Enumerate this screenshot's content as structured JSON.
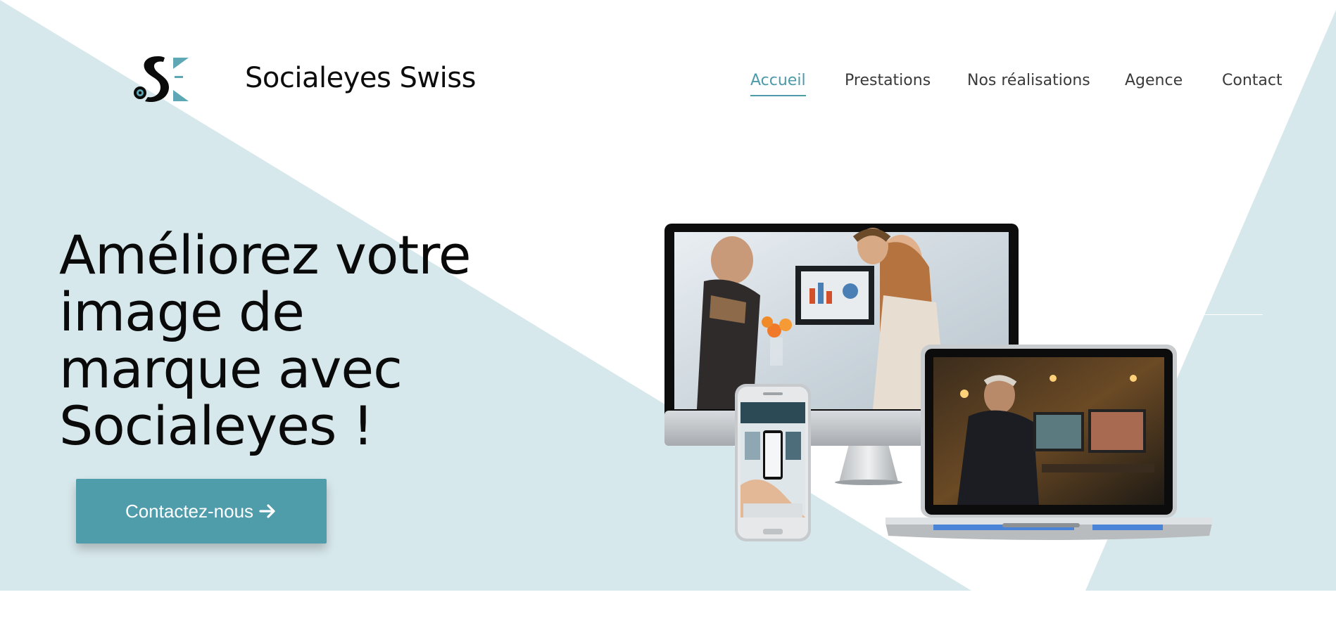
{
  "brand": {
    "name": "Socialeyes Swiss",
    "logo_icon": "socialeyes-se-logo"
  },
  "nav": {
    "items": [
      {
        "label": "Accueil",
        "active": true
      },
      {
        "label": "Prestations",
        "active": false
      },
      {
        "label": "Nos réalisations",
        "active": false
      },
      {
        "label": "Agence",
        "active": false
      },
      {
        "label": "Contact",
        "active": false
      }
    ]
  },
  "hero": {
    "headline_lines": [
      "Améliorez votre",
      "image de",
      "marque avec",
      "Socialeyes !"
    ],
    "cta_label": "Contactez-nous",
    "cta_icon": "arrow-right-icon",
    "image": "device-mockups-monitor-phone-laptop"
  },
  "colors": {
    "accent": "#4f9cab",
    "nav_active": "#4d9aa9",
    "hero_bg": "#d7e8ec",
    "text": "#0a0a0a"
  }
}
